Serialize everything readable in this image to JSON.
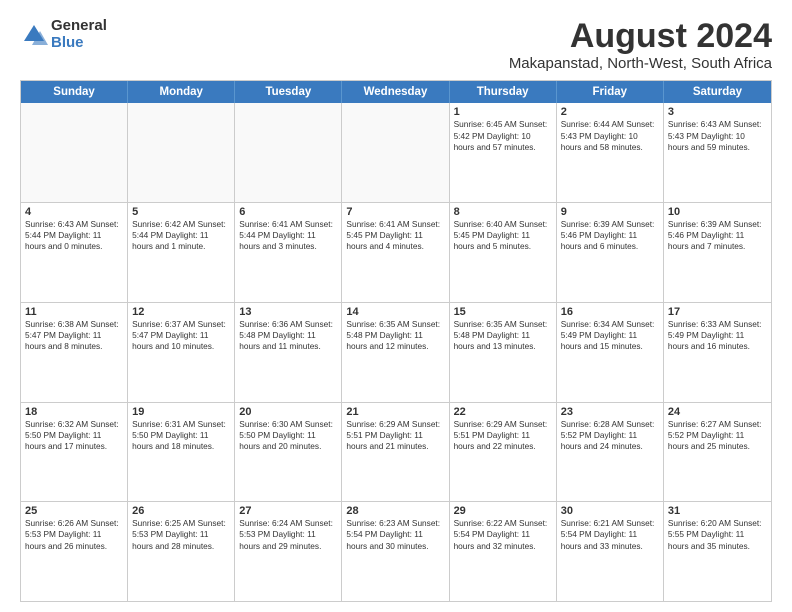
{
  "header": {
    "logo_general": "General",
    "logo_blue": "Blue",
    "title": "August 2024",
    "subtitle": "Makapanstad, North-West, South Africa"
  },
  "days": [
    "Sunday",
    "Monday",
    "Tuesday",
    "Wednesday",
    "Thursday",
    "Friday",
    "Saturday"
  ],
  "weeks": [
    [
      {
        "day": "",
        "info": ""
      },
      {
        "day": "",
        "info": ""
      },
      {
        "day": "",
        "info": ""
      },
      {
        "day": "",
        "info": ""
      },
      {
        "day": "1",
        "info": "Sunrise: 6:45 AM\nSunset: 5:42 PM\nDaylight: 10 hours\nand 57 minutes."
      },
      {
        "day": "2",
        "info": "Sunrise: 6:44 AM\nSunset: 5:43 PM\nDaylight: 10 hours\nand 58 minutes."
      },
      {
        "day": "3",
        "info": "Sunrise: 6:43 AM\nSunset: 5:43 PM\nDaylight: 10 hours\nand 59 minutes."
      }
    ],
    [
      {
        "day": "4",
        "info": "Sunrise: 6:43 AM\nSunset: 5:44 PM\nDaylight: 11 hours\nand 0 minutes."
      },
      {
        "day": "5",
        "info": "Sunrise: 6:42 AM\nSunset: 5:44 PM\nDaylight: 11 hours\nand 1 minute."
      },
      {
        "day": "6",
        "info": "Sunrise: 6:41 AM\nSunset: 5:44 PM\nDaylight: 11 hours\nand 3 minutes."
      },
      {
        "day": "7",
        "info": "Sunrise: 6:41 AM\nSunset: 5:45 PM\nDaylight: 11 hours\nand 4 minutes."
      },
      {
        "day": "8",
        "info": "Sunrise: 6:40 AM\nSunset: 5:45 PM\nDaylight: 11 hours\nand 5 minutes."
      },
      {
        "day": "9",
        "info": "Sunrise: 6:39 AM\nSunset: 5:46 PM\nDaylight: 11 hours\nand 6 minutes."
      },
      {
        "day": "10",
        "info": "Sunrise: 6:39 AM\nSunset: 5:46 PM\nDaylight: 11 hours\nand 7 minutes."
      }
    ],
    [
      {
        "day": "11",
        "info": "Sunrise: 6:38 AM\nSunset: 5:47 PM\nDaylight: 11 hours\nand 8 minutes."
      },
      {
        "day": "12",
        "info": "Sunrise: 6:37 AM\nSunset: 5:47 PM\nDaylight: 11 hours\nand 10 minutes."
      },
      {
        "day": "13",
        "info": "Sunrise: 6:36 AM\nSunset: 5:48 PM\nDaylight: 11 hours\nand 11 minutes."
      },
      {
        "day": "14",
        "info": "Sunrise: 6:35 AM\nSunset: 5:48 PM\nDaylight: 11 hours\nand 12 minutes."
      },
      {
        "day": "15",
        "info": "Sunrise: 6:35 AM\nSunset: 5:48 PM\nDaylight: 11 hours\nand 13 minutes."
      },
      {
        "day": "16",
        "info": "Sunrise: 6:34 AM\nSunset: 5:49 PM\nDaylight: 11 hours\nand 15 minutes."
      },
      {
        "day": "17",
        "info": "Sunrise: 6:33 AM\nSunset: 5:49 PM\nDaylight: 11 hours\nand 16 minutes."
      }
    ],
    [
      {
        "day": "18",
        "info": "Sunrise: 6:32 AM\nSunset: 5:50 PM\nDaylight: 11 hours\nand 17 minutes."
      },
      {
        "day": "19",
        "info": "Sunrise: 6:31 AM\nSunset: 5:50 PM\nDaylight: 11 hours\nand 18 minutes."
      },
      {
        "day": "20",
        "info": "Sunrise: 6:30 AM\nSunset: 5:50 PM\nDaylight: 11 hours\nand 20 minutes."
      },
      {
        "day": "21",
        "info": "Sunrise: 6:29 AM\nSunset: 5:51 PM\nDaylight: 11 hours\nand 21 minutes."
      },
      {
        "day": "22",
        "info": "Sunrise: 6:29 AM\nSunset: 5:51 PM\nDaylight: 11 hours\nand 22 minutes."
      },
      {
        "day": "23",
        "info": "Sunrise: 6:28 AM\nSunset: 5:52 PM\nDaylight: 11 hours\nand 24 minutes."
      },
      {
        "day": "24",
        "info": "Sunrise: 6:27 AM\nSunset: 5:52 PM\nDaylight: 11 hours\nand 25 minutes."
      }
    ],
    [
      {
        "day": "25",
        "info": "Sunrise: 6:26 AM\nSunset: 5:53 PM\nDaylight: 11 hours\nand 26 minutes."
      },
      {
        "day": "26",
        "info": "Sunrise: 6:25 AM\nSunset: 5:53 PM\nDaylight: 11 hours\nand 28 minutes."
      },
      {
        "day": "27",
        "info": "Sunrise: 6:24 AM\nSunset: 5:53 PM\nDaylight: 11 hours\nand 29 minutes."
      },
      {
        "day": "28",
        "info": "Sunrise: 6:23 AM\nSunset: 5:54 PM\nDaylight: 11 hours\nand 30 minutes."
      },
      {
        "day": "29",
        "info": "Sunrise: 6:22 AM\nSunset: 5:54 PM\nDaylight: 11 hours\nand 32 minutes."
      },
      {
        "day": "30",
        "info": "Sunrise: 6:21 AM\nSunset: 5:54 PM\nDaylight: 11 hours\nand 33 minutes."
      },
      {
        "day": "31",
        "info": "Sunrise: 6:20 AM\nSunset: 5:55 PM\nDaylight: 11 hours\nand 35 minutes."
      }
    ]
  ]
}
